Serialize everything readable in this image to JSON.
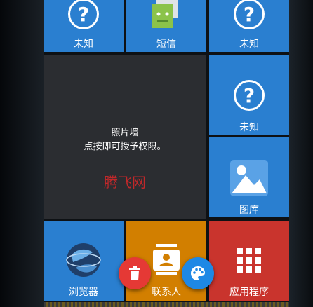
{
  "tiles": {
    "unknown_1": {
      "label": "未知"
    },
    "sms": {
      "label": "短信"
    },
    "unknown_2": {
      "label": "未知"
    },
    "photo_wall": {
      "title": "照片墙",
      "subtitle": "点按即可授予权限。"
    },
    "unknown_3": {
      "label": "未知"
    },
    "gallery": {
      "label": "图库"
    },
    "browser": {
      "label": "浏览器"
    },
    "contacts": {
      "label": "联系人"
    },
    "apps": {
      "label": "应用程序"
    }
  },
  "watermark": "腾飞网",
  "icons": {
    "unknown": "question-circle-icon",
    "sms": "android-message-icon",
    "gallery": "image-icon",
    "browser": "globe-icon",
    "contacts": "contact-card-icon",
    "apps": "grid-icon",
    "delete": "trash-icon",
    "theme": "palette-icon"
  },
  "colors": {
    "tile_blue": "#2a7fd0",
    "tile_dark": "#2b2d31",
    "tile_orange": "#d27f00",
    "tile_red": "#c9342d",
    "fab_red": "#e53935",
    "fab_blue": "#1e88e5",
    "watermark": "#c0282a"
  }
}
